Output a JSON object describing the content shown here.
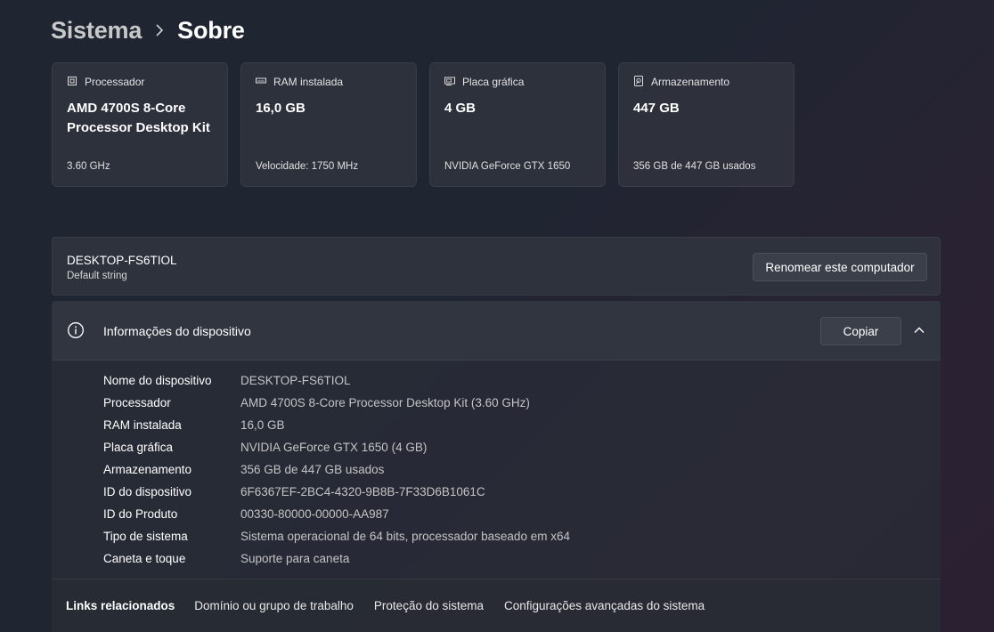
{
  "breadcrumb": {
    "parent": "Sistema",
    "separator": "›",
    "current": "Sobre"
  },
  "cards": [
    {
      "icon": "processor-icon",
      "label": "Processador",
      "value": "AMD 4700S 8-Core Processor Desktop Kit",
      "footer": "3.60 GHz"
    },
    {
      "icon": "ram-icon",
      "label": "RAM instalada",
      "value": "16,0 GB",
      "footer": "Velocidade: 1750 MHz"
    },
    {
      "icon": "gpu-icon",
      "label": "Placa gráfica",
      "value": "4 GB",
      "footer": "NVIDIA GeForce GTX 1650"
    },
    {
      "icon": "storage-icon",
      "label": "Armazenamento",
      "value": "447 GB",
      "footer": "356 GB de 447 GB usados"
    }
  ],
  "rename": {
    "pc_name": "DESKTOP-FS6TIOL",
    "subtitle": "Default string",
    "button_label": "Renomear este computador"
  },
  "device_info": {
    "title": "Informações do dispositivo",
    "copy_label": "Copiar",
    "rows": [
      {
        "label": "Nome do dispositivo",
        "value": "DESKTOP-FS6TIOL"
      },
      {
        "label": "Processador",
        "value": "AMD 4700S 8-Core Processor Desktop Kit (3.60 GHz)"
      },
      {
        "label": "RAM instalada",
        "value": "16,0 GB"
      },
      {
        "label": "Placa gráfica",
        "value": "NVIDIA GeForce GTX 1650 (4 GB)"
      },
      {
        "label": "Armazenamento",
        "value": "356 GB de 447 GB usados"
      },
      {
        "label": "ID do dispositivo",
        "value": "6F6367EF-2BC4-4320-9B8B-7F33D6B1061C"
      },
      {
        "label": "ID do Produto",
        "value": "00330-80000-00000-AA987"
      },
      {
        "label": "Tipo de sistema",
        "value": "Sistema operacional de 64 bits, processador baseado em x64"
      },
      {
        "label": "Caneta e toque",
        "value": "Suporte para caneta"
      }
    ]
  },
  "related_links": {
    "label": "Links relacionados",
    "links": [
      "Domínio ou grupo de trabalho",
      "Proteção do sistema",
      "Configurações avançadas do sistema"
    ]
  }
}
